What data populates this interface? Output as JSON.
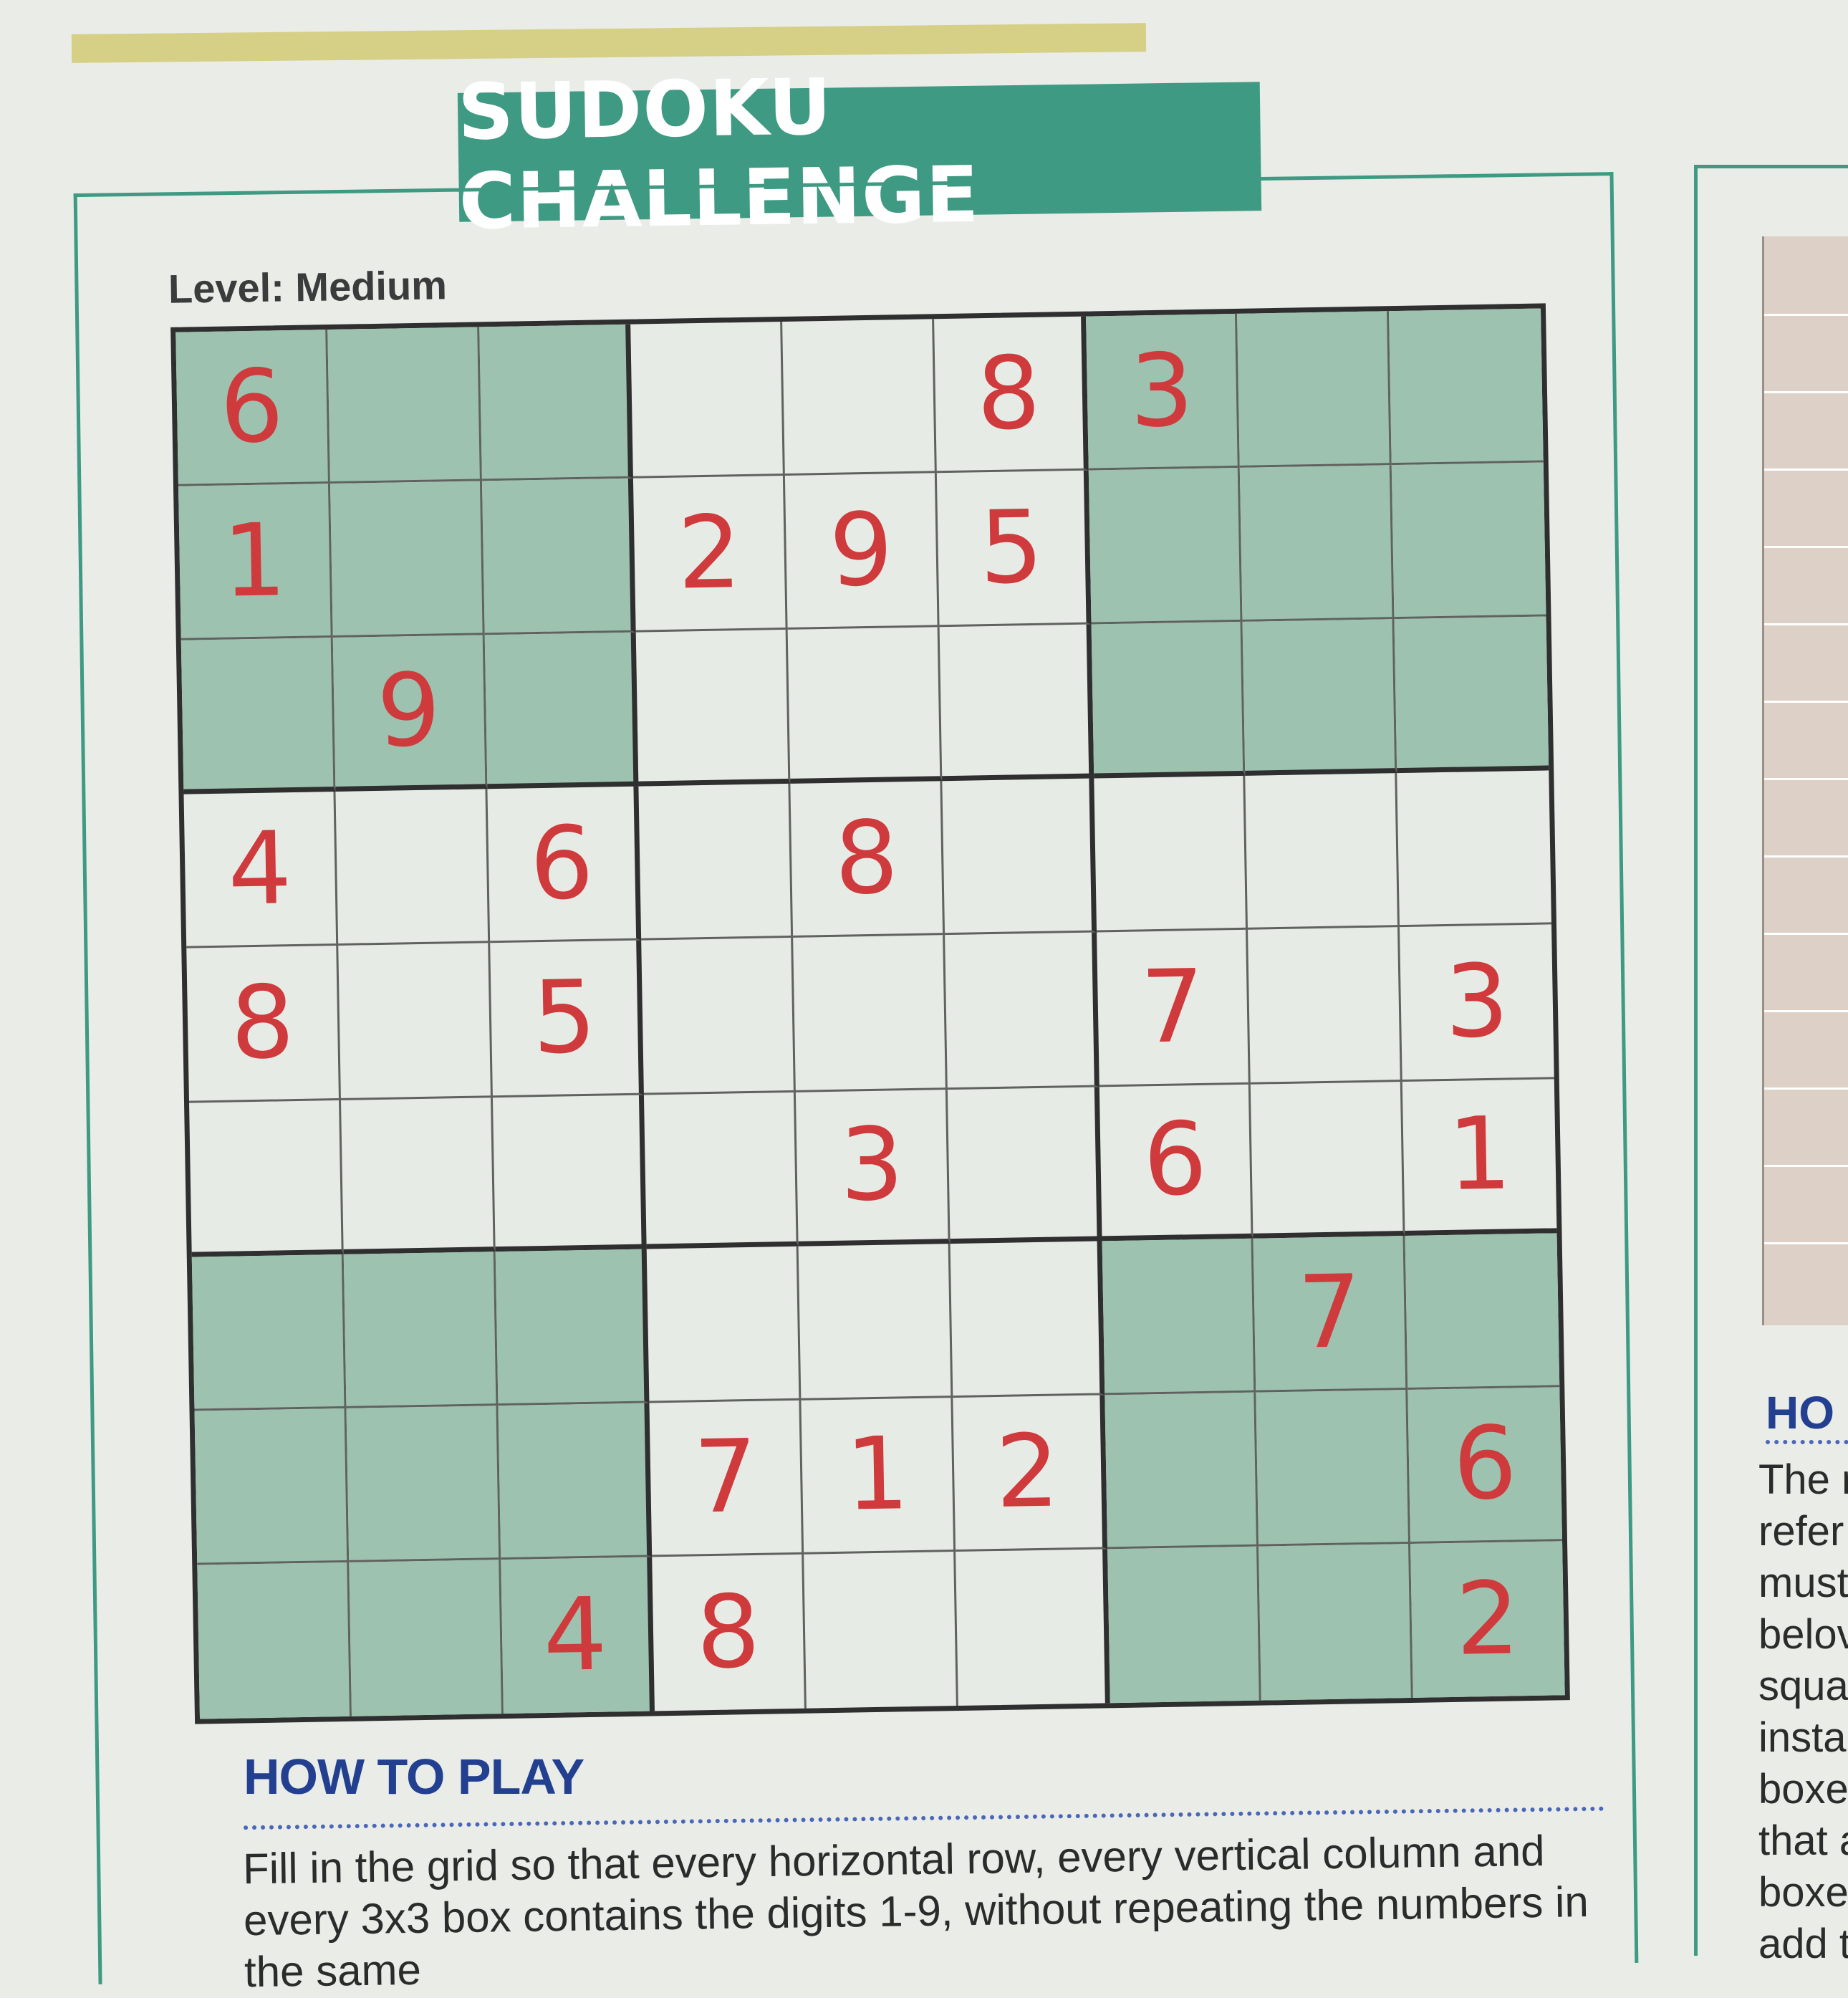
{
  "title": "SUDOKU CHALLENGE",
  "level": "Level: Medium",
  "grid": [
    [
      "6",
      "",
      "",
      "",
      "",
      "8",
      "3",
      "",
      ""
    ],
    [
      "1",
      "",
      "",
      "2",
      "9",
      "5",
      "",
      "",
      ""
    ],
    [
      "",
      "9",
      "",
      "",
      "",
      "",
      "",
      "",
      ""
    ],
    [
      "4",
      "",
      "6",
      "",
      "8",
      "",
      "",
      "",
      ""
    ],
    [
      "8",
      "",
      "5",
      "",
      "",
      "",
      "7",
      "",
      "3"
    ],
    [
      "",
      "",
      "",
      "",
      "3",
      "",
      "6",
      "",
      "1"
    ],
    [
      "",
      "",
      "",
      "",
      "",
      "",
      "",
      "7",
      ""
    ],
    [
      "",
      "",
      "",
      "7",
      "1",
      "2",
      "",
      "",
      "6"
    ],
    [
      "",
      "",
      "4",
      "8",
      "",
      "",
      "",
      "",
      "2"
    ]
  ],
  "colors": {
    "shade": "#9ec2b0",
    "digit": "#cf3a3c",
    "accent": "#3e9a82",
    "heading": "#233f8f"
  },
  "how_to_play": {
    "heading": "HOW TO PLAY",
    "text": "Fill in the grid so that every horizontal row, every vertical column and every 3x3 box contains the digits 1-9, without repeating the numbers in the same"
  },
  "right_column": {
    "heading": "HO",
    "lines": [
      "The r",
      "refer",
      "must",
      "belov",
      "squar",
      "instar",
      "boxes",
      "that a",
      "boxes",
      "add t"
    ]
  }
}
